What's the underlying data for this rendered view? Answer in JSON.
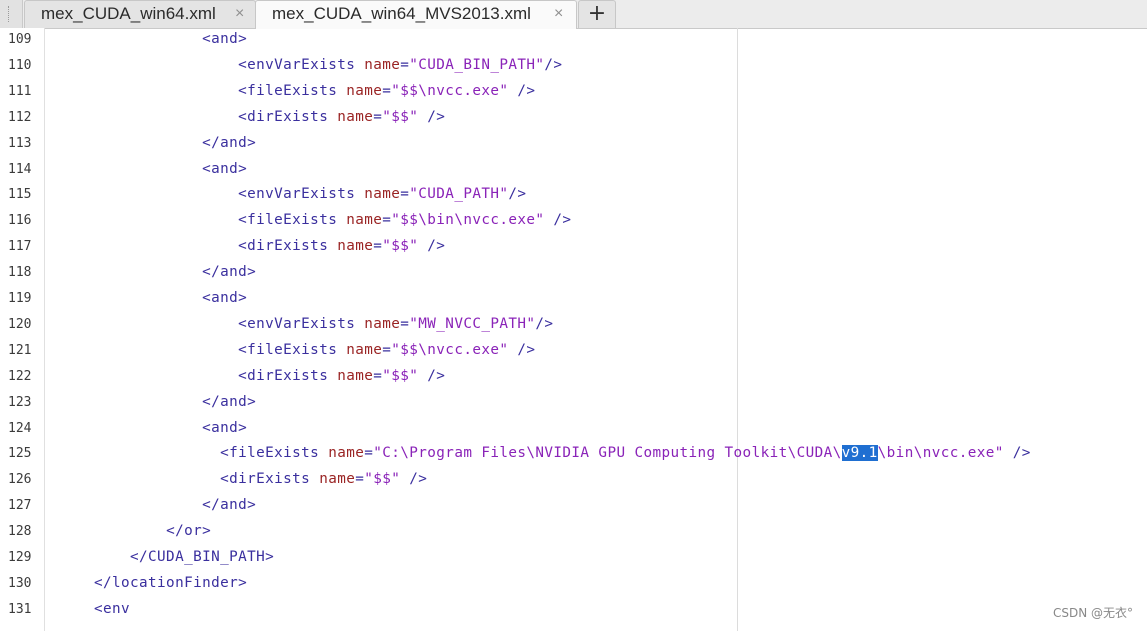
{
  "tabs": [
    {
      "title": "mex_CUDA_win64.xml",
      "close": "×"
    },
    {
      "title": "mex_CUDA_win64_MVS2013.xml",
      "close": "×"
    }
  ],
  "new_tab_label": "+",
  "lines": [
    {
      "num": "109",
      "indent": "            ",
      "parts": [
        {
          "c": "tag",
          "t": "<and>"
        }
      ]
    },
    {
      "num": "110",
      "indent": "                ",
      "parts": [
        {
          "c": "tag",
          "t": "<envVarExists "
        },
        {
          "c": "attr",
          "t": "name"
        },
        {
          "c": "tag",
          "t": "="
        },
        {
          "c": "val",
          "t": "\"CUDA_BIN_PATH\""
        },
        {
          "c": "tag",
          "t": "/>"
        }
      ]
    },
    {
      "num": "111",
      "indent": "                ",
      "parts": [
        {
          "c": "tag",
          "t": "<fileExists "
        },
        {
          "c": "attr",
          "t": "name"
        },
        {
          "c": "tag",
          "t": "="
        },
        {
          "c": "val",
          "t": "\"$$\\nvcc.exe\""
        },
        {
          "c": "tag",
          "t": " />"
        }
      ]
    },
    {
      "num": "112",
      "indent": "                ",
      "parts": [
        {
          "c": "tag",
          "t": "<dirExists "
        },
        {
          "c": "attr",
          "t": "name"
        },
        {
          "c": "tag",
          "t": "="
        },
        {
          "c": "val",
          "t": "\"$$\""
        },
        {
          "c": "tag",
          "t": " />"
        }
      ]
    },
    {
      "num": "113",
      "indent": "            ",
      "parts": [
        {
          "c": "tag",
          "t": "</and>"
        }
      ]
    },
    {
      "num": "114",
      "indent": "            ",
      "parts": [
        {
          "c": "tag",
          "t": "<and>"
        }
      ]
    },
    {
      "num": "115",
      "indent": "                ",
      "parts": [
        {
          "c": "tag",
          "t": "<envVarExists "
        },
        {
          "c": "attr",
          "t": "name"
        },
        {
          "c": "tag",
          "t": "="
        },
        {
          "c": "val",
          "t": "\"CUDA_PATH\""
        },
        {
          "c": "tag",
          "t": "/>"
        }
      ]
    },
    {
      "num": "116",
      "indent": "                ",
      "parts": [
        {
          "c": "tag",
          "t": "<fileExists "
        },
        {
          "c": "attr",
          "t": "name"
        },
        {
          "c": "tag",
          "t": "="
        },
        {
          "c": "val",
          "t": "\"$$\\bin\\nvcc.exe\""
        },
        {
          "c": "tag",
          "t": " />"
        }
      ]
    },
    {
      "num": "117",
      "indent": "                ",
      "parts": [
        {
          "c": "tag",
          "t": "<dirExists "
        },
        {
          "c": "attr",
          "t": "name"
        },
        {
          "c": "tag",
          "t": "="
        },
        {
          "c": "val",
          "t": "\"$$\""
        },
        {
          "c": "tag",
          "t": " />"
        }
      ]
    },
    {
      "num": "118",
      "indent": "            ",
      "parts": [
        {
          "c": "tag",
          "t": "</and>"
        }
      ]
    },
    {
      "num": "119",
      "indent": "            ",
      "parts": [
        {
          "c": "tag",
          "t": "<and>"
        }
      ]
    },
    {
      "num": "120",
      "indent": "                ",
      "parts": [
        {
          "c": "tag",
          "t": "<envVarExists "
        },
        {
          "c": "attr",
          "t": "name"
        },
        {
          "c": "tag",
          "t": "="
        },
        {
          "c": "val",
          "t": "\"MW_NVCC_PATH\""
        },
        {
          "c": "tag",
          "t": "/>"
        }
      ]
    },
    {
      "num": "121",
      "indent": "                ",
      "parts": [
        {
          "c": "tag",
          "t": "<fileExists "
        },
        {
          "c": "attr",
          "t": "name"
        },
        {
          "c": "tag",
          "t": "="
        },
        {
          "c": "val",
          "t": "\"$$\\nvcc.exe\""
        },
        {
          "c": "tag",
          "t": " />"
        }
      ]
    },
    {
      "num": "122",
      "indent": "                ",
      "parts": [
        {
          "c": "tag",
          "t": "<dirExists "
        },
        {
          "c": "attr",
          "t": "name"
        },
        {
          "c": "tag",
          "t": "="
        },
        {
          "c": "val",
          "t": "\"$$\""
        },
        {
          "c": "tag",
          "t": " />"
        }
      ]
    },
    {
      "num": "123",
      "indent": "            ",
      "parts": [
        {
          "c": "tag",
          "t": "</and>"
        }
      ]
    },
    {
      "num": "124",
      "indent": "            ",
      "parts": [
        {
          "c": "tag",
          "t": "<and>"
        }
      ]
    },
    {
      "num": "125",
      "indent": "              ",
      "parts": [
        {
          "c": "tag",
          "t": "<fileExists "
        },
        {
          "c": "attr",
          "t": "name"
        },
        {
          "c": "tag",
          "t": "="
        },
        {
          "c": "val",
          "t": "\"C:\\Program Files\\NVIDIA GPU Computing Toolkit\\CUDA\\"
        },
        {
          "c": "sel",
          "t": "v9.1"
        },
        {
          "c": "val",
          "t": "\\bin\\nvcc.exe\""
        },
        {
          "c": "tag",
          "t": " />"
        }
      ]
    },
    {
      "num": "126",
      "indent": "              ",
      "parts": [
        {
          "c": "tag",
          "t": "<dirExists "
        },
        {
          "c": "attr",
          "t": "name"
        },
        {
          "c": "tag",
          "t": "="
        },
        {
          "c": "val",
          "t": "\"$$\""
        },
        {
          "c": "tag",
          "t": " />"
        }
      ]
    },
    {
      "num": "127",
      "indent": "            ",
      "parts": [
        {
          "c": "tag",
          "t": "</and>"
        }
      ]
    },
    {
      "num": "128",
      "indent": "        ",
      "parts": [
        {
          "c": "tag",
          "t": "</or>"
        }
      ]
    },
    {
      "num": "129",
      "indent": "    ",
      "parts": [
        {
          "c": "tag",
          "t": "</CUDA_BIN_PATH>"
        }
      ]
    },
    {
      "num": "130",
      "indent": "",
      "parts": [
        {
          "c": "tag",
          "t": "</locationFinder>"
        }
      ]
    },
    {
      "num": "131",
      "indent": "",
      "parts": [
        {
          "c": "tag",
          "t": "<env"
        }
      ]
    }
  ],
  "watermark": "CSDN @无衣°"
}
